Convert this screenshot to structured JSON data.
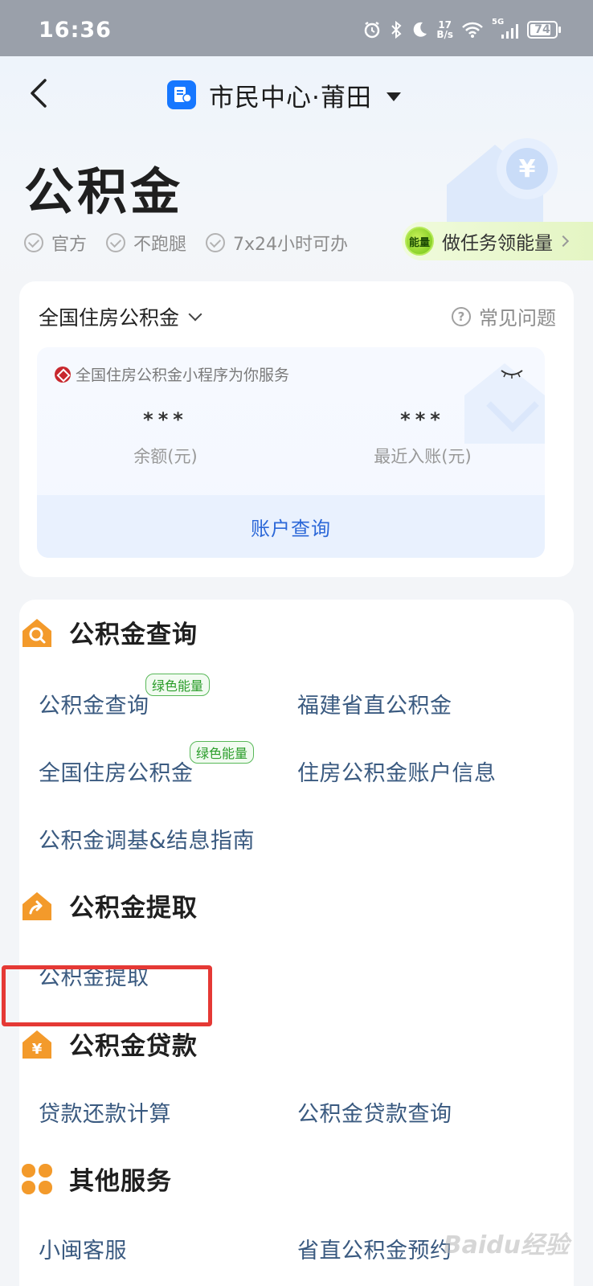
{
  "status_bar": {
    "time": "16:36",
    "net_speed_value": "17",
    "net_speed_unit": "B/s",
    "signal_label": "5G",
    "battery": "74"
  },
  "nav": {
    "city_name": "市民中心·莆田"
  },
  "header": {
    "title": "公积金",
    "tags": [
      "官方",
      "不跑腿",
      "7x24小时可办"
    ],
    "energy_badge": "能量",
    "energy_task": "做任务领能量"
  },
  "account": {
    "scope": "全国住房公积金",
    "faq": "常见问题",
    "provider": "全国住房公积金小程序为你服务",
    "balance_value": "***",
    "balance_label": "余额(元)",
    "recent_value": "***",
    "recent_label": "最近入账(元)",
    "query_button": "账户查询"
  },
  "sections": {
    "query": {
      "title": "公积金查询",
      "items": [
        "公积金查询",
        "福建省直公积金",
        "全国住房公积金",
        "住房公积金账户信息",
        "公积金调基&结息指南"
      ],
      "tag": "绿色能量"
    },
    "withdraw": {
      "title": "公积金提取",
      "items": [
        "公积金提取"
      ]
    },
    "loan": {
      "title": "公积金贷款",
      "items": [
        "贷款还款计算",
        "公积金贷款查询"
      ]
    },
    "other": {
      "title": "其他服务",
      "items": [
        "小闽客服",
        "省直公积金预约"
      ]
    }
  },
  "watermark": "Baidu经验",
  "colors": {
    "accent_blue": "#2c68d8",
    "link_text": "#3a5a80",
    "energy_green": "#2a9d2a",
    "section_orange": "#f39a2b",
    "highlight_red": "#e53935"
  }
}
